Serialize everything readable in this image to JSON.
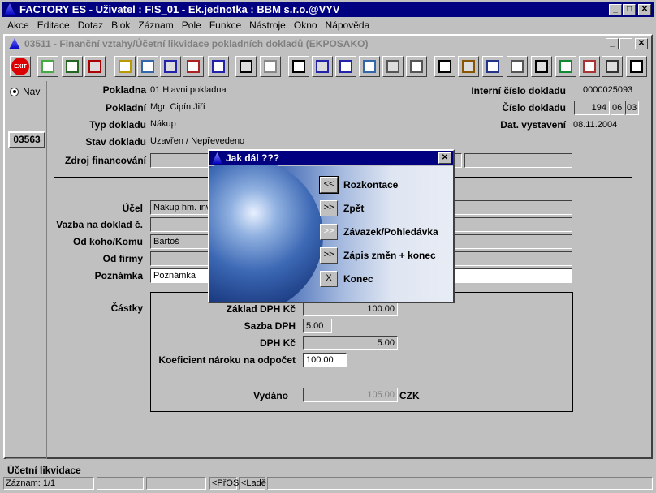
{
  "app": {
    "title": "FACTORY ES - Uživatel : FIS_01 - Ek.jednotka : BBM s.r.o.@VYV"
  },
  "menu": [
    "Akce",
    "Editace",
    "Dotaz",
    "Blok",
    "Záznam",
    "Pole",
    "Funkce",
    "Nástroje",
    "Okno",
    "Nápověda"
  ],
  "window": {
    "title": "03511 - Finanční vztahy/Účetní likvidace pokladních dokladů (EKPOSAKO)"
  },
  "toolbar": [
    "exit-icon",
    "insert-record-icon",
    "save-icon",
    "delete-record-icon",
    "query-icon",
    "execute-query-icon",
    "sort-asc-icon",
    "sort-desc-icon",
    "sort-multi-icon",
    "print-icon",
    "print-preview-icon",
    "cut-icon",
    "copy-icon",
    "paste-icon",
    "find-icon",
    "next-icon",
    "last-icon",
    "calculator-icon",
    "settings-icon",
    "chart-icon",
    "clock-icon",
    "sum-icon",
    "excel-icon",
    "export-icon",
    "list-icon",
    "help-icon"
  ],
  "exit_label": "EXIT",
  "nav": {
    "radio_label": "Nav",
    "record_button": "03563"
  },
  "header": {
    "pokladna": {
      "label": "Pokladna",
      "value": "01 Hlavni pokladna"
    },
    "pokladni": {
      "label": "Pokladní",
      "value": "Mgr. Cipín Jiří"
    },
    "typ": {
      "label": "Typ dokladu",
      "value": "Nákup"
    },
    "stav": {
      "label": "Stav dokladu",
      "value": "Uzavřen / Nepřevedeno"
    },
    "zdroj": {
      "label": "Zdroj financování",
      "value": ""
    },
    "interni": {
      "label": "Interní číslo dokladu",
      "value": "0000025093"
    },
    "cislo": {
      "label": "Číslo dokladu",
      "part1": "194",
      "part2": "06",
      "part3": "03"
    },
    "datum": {
      "label": "Dat. vystavení",
      "value": "08.11.2004"
    }
  },
  "form": {
    "ucel": {
      "label": "Účel",
      "value": "Nakup hm. inv"
    },
    "vazba": {
      "label": "Vazba na doklad č.",
      "value": ""
    },
    "odkoho": {
      "label": "Od koho/Komu",
      "value": "Bartoš"
    },
    "odfirmy": {
      "label": "Od firmy",
      "value": ""
    },
    "poznamka": {
      "label": "Poznámka",
      "value": "Poznámka"
    }
  },
  "castky": {
    "label": "Částky",
    "zaklad": {
      "label": "Základ DPH Kč",
      "value": "100.00"
    },
    "sazba": {
      "label": "Sazba DPH",
      "value": "5.00"
    },
    "dph": {
      "label": "DPH Kč",
      "value": "5.00"
    },
    "koef": {
      "label": "Koeficient nároku na odpočet",
      "value": "100.00"
    },
    "vydano": {
      "label": "Vydáno",
      "value": "105.00",
      "currency": "CZK"
    }
  },
  "dialog": {
    "title": "Jak dál ???",
    "close": "✕",
    "options": [
      {
        "button": "<<",
        "label": "Rozkontace"
      },
      {
        "button": ">>",
        "label": "Zpět"
      },
      {
        "button": ">>",
        "label": "Závazek/Pohledávka",
        "disabled": true
      },
      {
        "button": ">>",
        "label": "Zápis změn + konec"
      },
      {
        "button": "X",
        "label": "Konec"
      }
    ]
  },
  "status": {
    "label": "Účetní likvidace",
    "record": "Záznam: 1/1",
    "seg1": "",
    "seg2": "",
    "seg3": "<PřOS",
    "seg4": "<Ladě",
    "seg5": ""
  }
}
